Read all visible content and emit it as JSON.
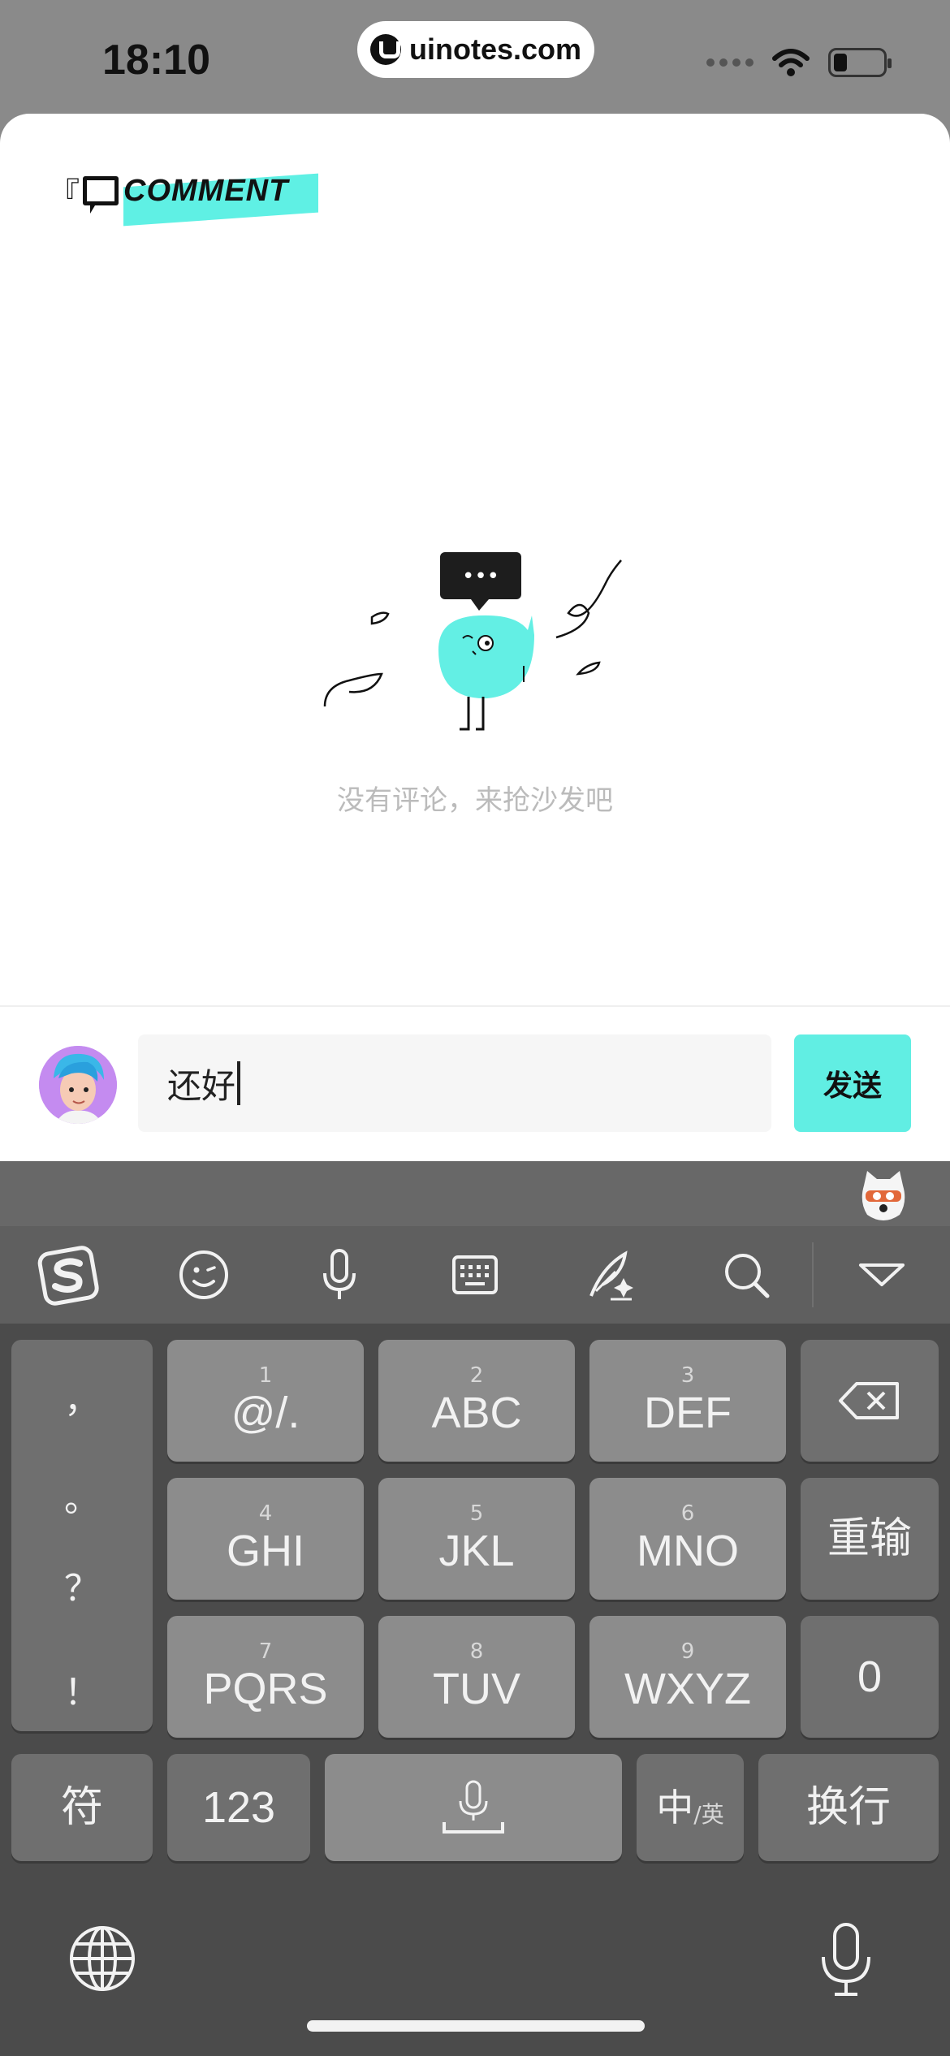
{
  "status_bar": {
    "time": "18:10",
    "url": "uinotes.com"
  },
  "comment_panel": {
    "header_open": "『",
    "header_title": "COMMENT",
    "header_close": "』",
    "empty_message": "没有评论，来抢沙发吧",
    "bubble_dots": "•••"
  },
  "composer": {
    "input_value": "还好",
    "send_label": "发送"
  },
  "keyboard": {
    "toolbar_icons": [
      "sogou-logo-icon",
      "emoji-icon",
      "microphone-icon",
      "keyboard-icon",
      "handwriting-icon",
      "search-icon",
      "collapse-keyboard-icon"
    ],
    "punctuation": [
      "，",
      "。",
      "？",
      "！"
    ],
    "keys": [
      {
        "num": "1",
        "label": "@/."
      },
      {
        "num": "2",
        "label": "ABC"
      },
      {
        "num": "3",
        "label": "DEF"
      },
      {
        "num": "4",
        "label": "GHI"
      },
      {
        "num": "5",
        "label": "JKL"
      },
      {
        "num": "6",
        "label": "MNO"
      },
      {
        "num": "7",
        "label": "PQRS"
      },
      {
        "num": "8",
        "label": "TUV"
      },
      {
        "num": "9",
        "label": "WXYZ"
      }
    ],
    "reinput_label": "重输",
    "zero_label": "0",
    "symbols_label": "符",
    "numbers_label": "123",
    "lang_label": "中",
    "lang_sub_label": "/英",
    "newline_label": "换行"
  }
}
